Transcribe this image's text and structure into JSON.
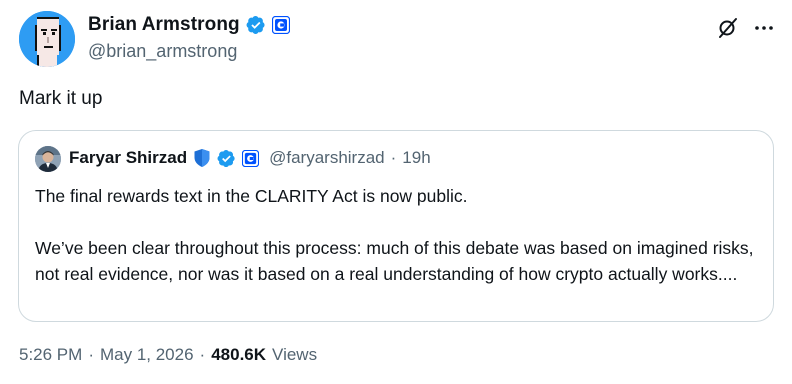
{
  "author": {
    "name": "Brian Armstrong",
    "handle": "@brian_armstrong",
    "verified_color": "#1d9bf0",
    "org_badge": "coinbase-badge-icon"
  },
  "post": {
    "text": "Mark it up"
  },
  "quoted": {
    "name": "Faryar Shirzad",
    "handle": "@faryarshirzad",
    "separator": "·",
    "time": "19h",
    "body": "The final rewards text in the CLARITY Act is now public.\n\nWe’ve been clear throughout this process: much of this debate was based on imagined risks, not real evidence, nor was it based on a real understanding of how crypto actually works...."
  },
  "meta": {
    "time": "5:26 PM",
    "separator1": "·",
    "date": "May 1, 2026",
    "separator2": "·",
    "views_count": "480.6K",
    "views_label": "Views"
  },
  "colors": {
    "text": "#0f1419",
    "secondary": "#536471",
    "border": "#cfd9de",
    "accent": "#1d9bf0"
  }
}
